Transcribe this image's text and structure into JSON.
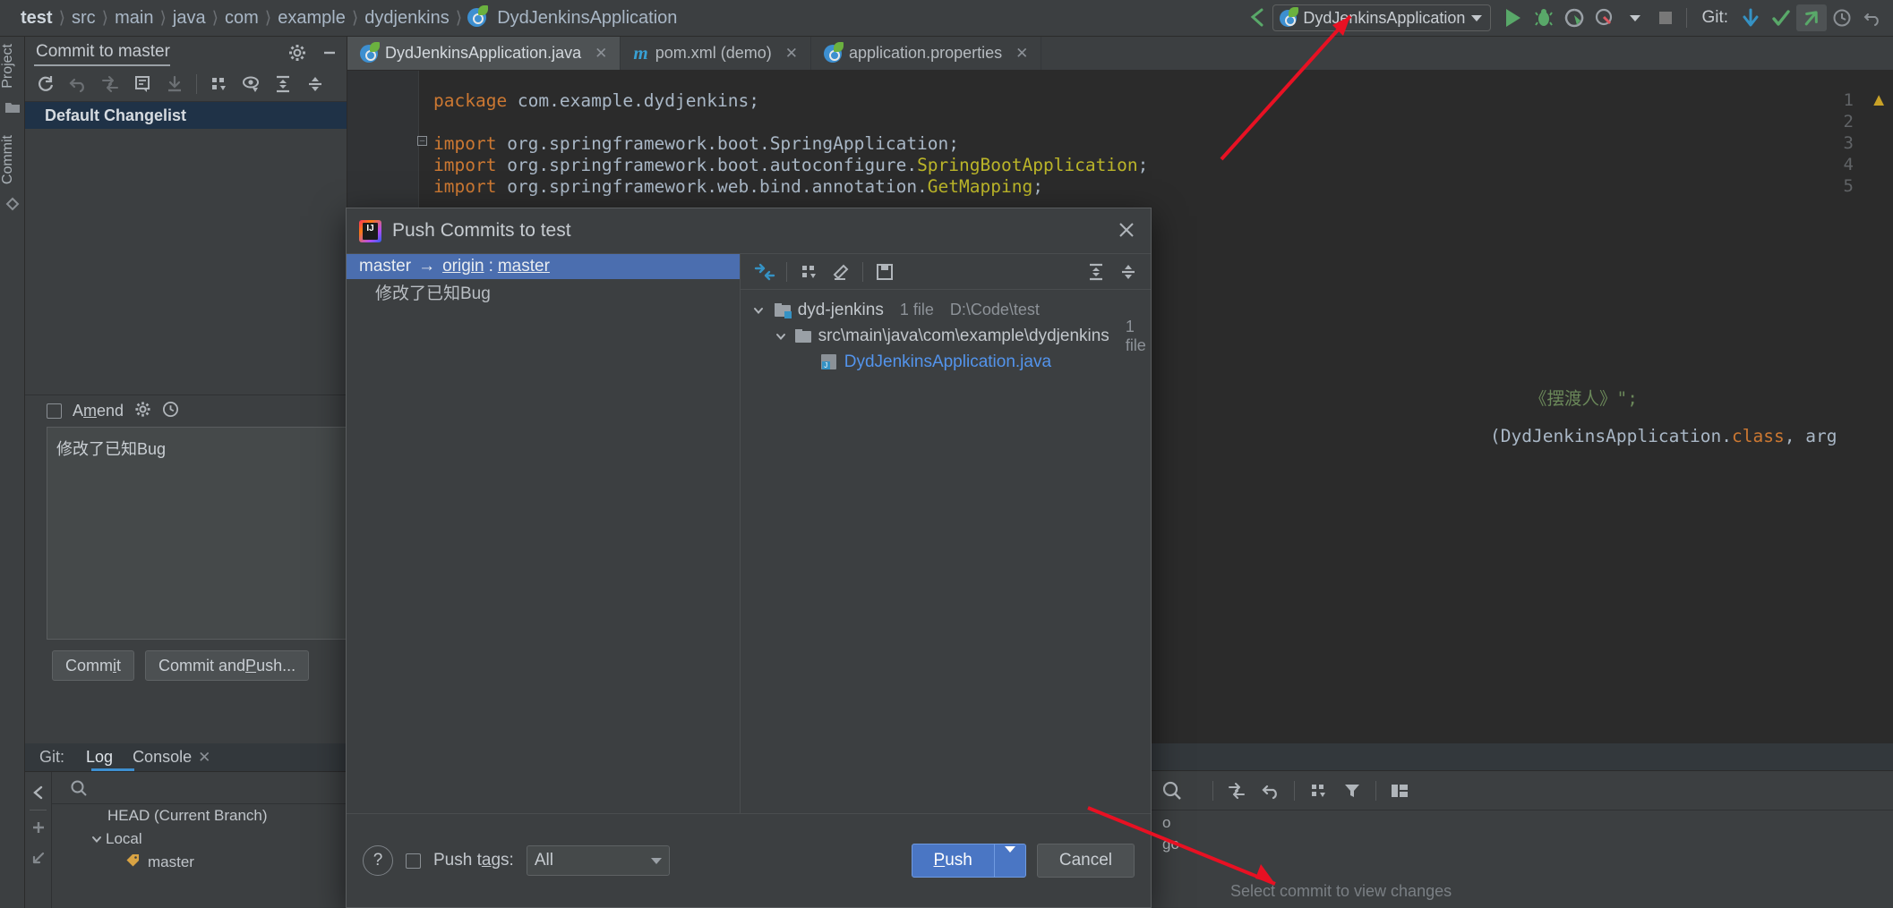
{
  "breadcrumb": {
    "items": [
      "test",
      "src",
      "main",
      "java",
      "com",
      "example",
      "dydjenkins"
    ],
    "final": "DydJenkinsApplication"
  },
  "toolbar": {
    "run_config": "DydJenkinsApplication",
    "git_label": "Git:",
    "icons": [
      "back-arrow-icon",
      "run-icon",
      "debug-icon",
      "run-with-coverage-icon",
      "profiler-icon",
      "stop-icon",
      "update-project-icon",
      "commit-icon",
      "push-icon",
      "history-icon",
      "rollback-icon"
    ]
  },
  "sidebar": {
    "project_tab": "Project",
    "commit_tab": "Commit"
  },
  "commit_panel": {
    "tab_label": "Commit to master",
    "changelist": "Default Changelist",
    "amend_label": "Amend",
    "message": "修改了已知Bug",
    "commit_button": "Commit",
    "commit_push_button": "Commit and Push..."
  },
  "git_panel": {
    "label": "Git:",
    "tabs": [
      {
        "label": "Log",
        "selected": true,
        "closable": false
      },
      {
        "label": "Console",
        "selected": false,
        "closable": true
      }
    ],
    "tree": [
      {
        "label": "HEAD (Current Branch)",
        "indent": 0,
        "chevron": "",
        "icon": ""
      },
      {
        "label": "Local",
        "indent": 0,
        "chevron": "down",
        "icon": ""
      },
      {
        "label": "master",
        "indent": 1,
        "chevron": "",
        "icon": "branch-tag-icon"
      }
    ]
  },
  "editor": {
    "tabs": [
      {
        "label": "DydJenkinsApplication.java",
        "icon": "spring-icon",
        "active": true
      },
      {
        "label": "pom.xml (demo)",
        "icon": "maven-icon",
        "active": false
      },
      {
        "label": "application.properties",
        "icon": "spring-icon",
        "active": false
      }
    ],
    "lines": [
      {
        "n": "1",
        "segments": [
          {
            "t": "package",
            "c": "kw"
          },
          {
            "t": " com.example.dydjenkins;",
            "c": ""
          }
        ]
      },
      {
        "n": "2",
        "segments": []
      },
      {
        "n": "3",
        "fold": true,
        "segments": [
          {
            "t": "import",
            "c": "kw"
          },
          {
            "t": " org.springframework.boot.SpringApplication;",
            "c": ""
          }
        ]
      },
      {
        "n": "4",
        "segments": [
          {
            "t": "import",
            "c": "kw"
          },
          {
            "t": " org.springframework.boot.autoconfigure.",
            "c": ""
          },
          {
            "t": "SpringBootApplication",
            "c": "ann"
          },
          {
            "t": ";",
            "c": ""
          }
        ]
      },
      {
        "n": "5",
        "segments": [
          {
            "t": "import",
            "c": "kw"
          },
          {
            "t": " org.springframework.web.bind.annotation.",
            "c": ""
          },
          {
            "t": "GetMapping",
            "c": "ann"
          },
          {
            "t": ";",
            "c": ""
          }
        ]
      }
    ],
    "fragment_string": "《摆渡人》\";",
    "fragment_code": "(DydJenkinsApplication.class, arg"
  },
  "dialog": {
    "title": "Push Commits to test",
    "push_row": {
      "source": "master",
      "arrow": "→",
      "remote": "origin",
      "colon": ":",
      "target": "master"
    },
    "commit_message": "修改了已知Bug",
    "file_tree": [
      {
        "label": "dyd-jenkins",
        "meta": "1 file",
        "meta2": "D:\\Code\\test",
        "indent": 0,
        "chevron": "down",
        "icon": "folder-module-icon"
      },
      {
        "label": "src\\main\\java\\com\\example\\dydjenkins",
        "meta": "1 file",
        "meta2": "",
        "indent": 1,
        "chevron": "down",
        "icon": "folder-icon"
      },
      {
        "label": "DydJenkinsApplication.java",
        "meta": "",
        "meta2": "",
        "indent": 2,
        "chevron": "",
        "icon": "java-file-icon",
        "is_file": true
      }
    ],
    "help_label": "?",
    "push_tags_label": "Push tags:",
    "push_tags_value": "All",
    "push_button": "Push",
    "cancel_button": "Cancel"
  },
  "bottom_right": {
    "status": "Select commit to view changes",
    "frag1": "o",
    "frag2": "go"
  },
  "colors": {
    "accent_blue": "#4b6eaf",
    "push_button": "#4a76c4",
    "link_blue": "#5394ec",
    "annotation_red": "#e81123",
    "tab_underline": "#3d8fd0"
  }
}
